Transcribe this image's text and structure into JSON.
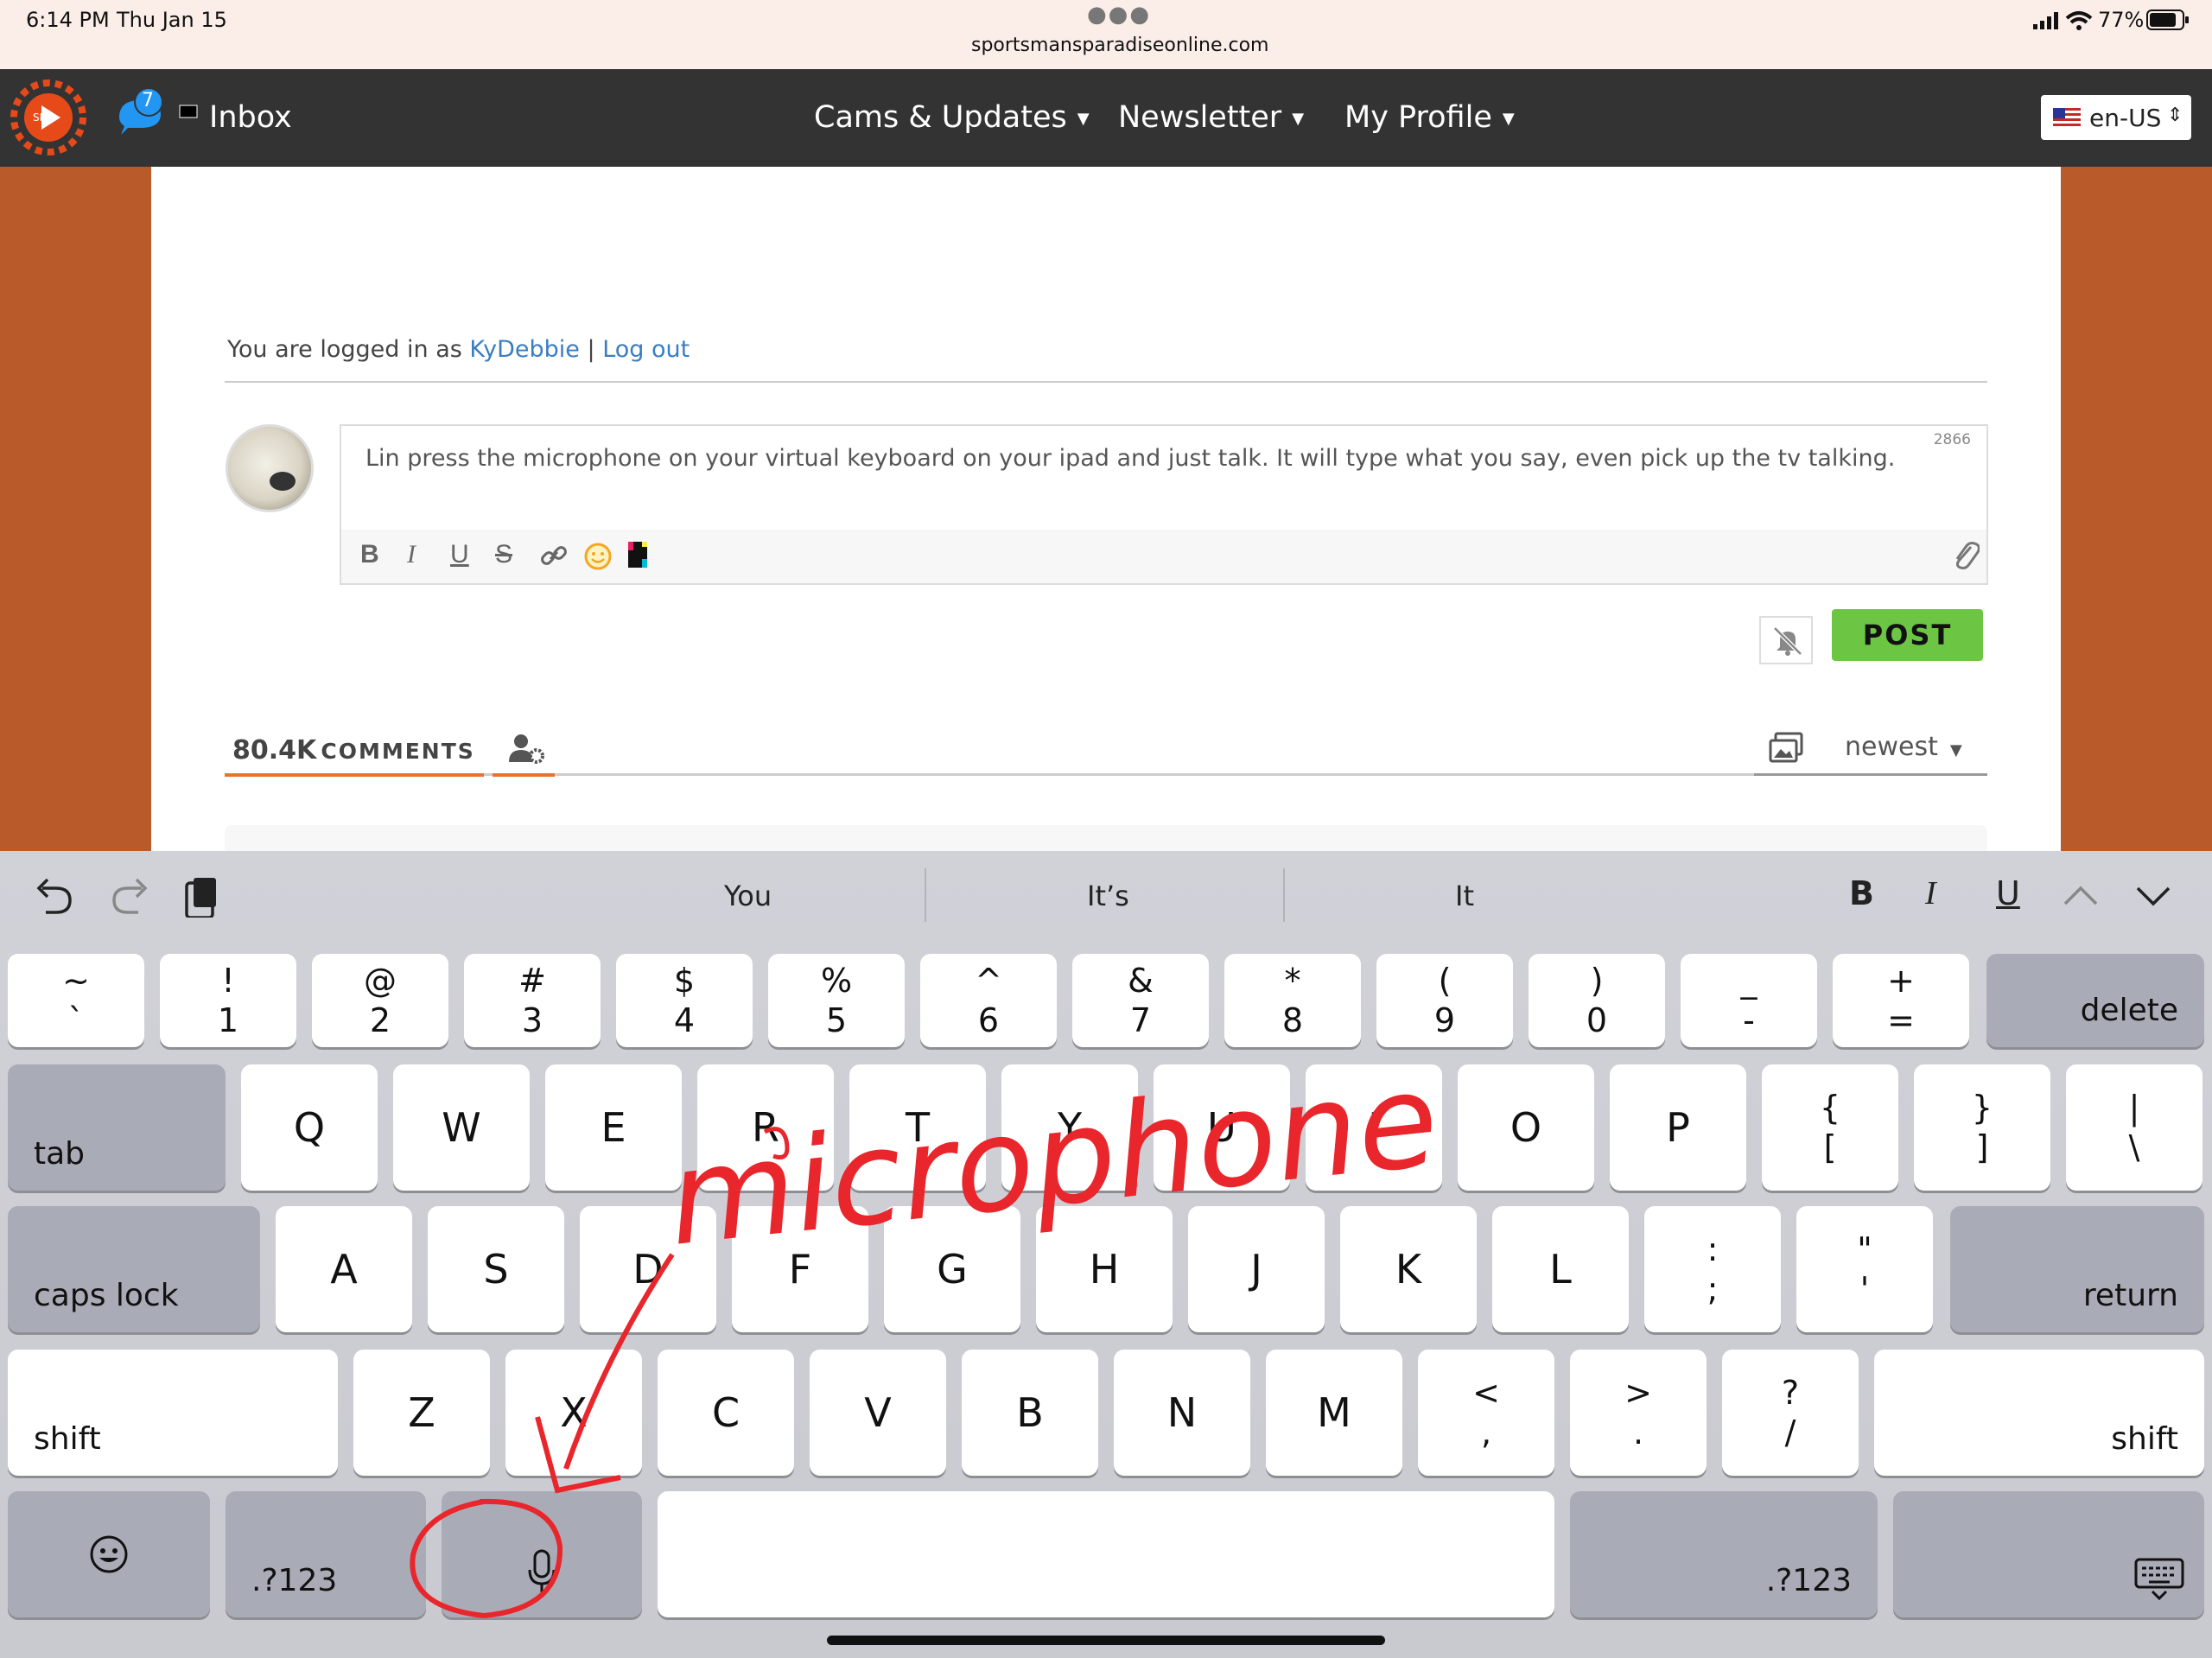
{
  "status": {
    "time": "6:14 PM",
    "date": "Thu Jan 15",
    "url": "sportsmansparadiseonline.com",
    "battery": "77%"
  },
  "nav": {
    "notif_count": "7",
    "inbox": "Inbox",
    "menu": [
      "Cams & Updates",
      "Newsletter",
      "My Profile"
    ],
    "locale": "en-US"
  },
  "comments": {
    "logged_prefix": "You are logged in as",
    "username": "KyDebbie",
    "separator": "|",
    "logout": "Log out",
    "char_count": "2866",
    "draft": "Lin press the microphone on your virtual keyboard on your ipad and just talk. It will type what you say, even pick up the tv talking.",
    "post": "POST",
    "count": "80.4K",
    "count_label": "COMMENTS",
    "sort": "newest"
  },
  "keyboard": {
    "suggestions": [
      "You",
      "It’s",
      "It"
    ],
    "format": [
      "B",
      "I",
      "U"
    ],
    "row1": [
      [
        "~",
        "`"
      ],
      [
        "!",
        "1"
      ],
      [
        "@",
        "2"
      ],
      [
        "#",
        "3"
      ],
      [
        "$",
        "4"
      ],
      [
        "%",
        "5"
      ],
      [
        "^",
        "6"
      ],
      [
        "&",
        "7"
      ],
      [
        "*",
        "8"
      ],
      [
        "(",
        "9"
      ],
      [
        ")",
        "0"
      ],
      [
        "_",
        "-"
      ],
      [
        "+",
        "="
      ]
    ],
    "delete": "delete",
    "tab": "tab",
    "row2": [
      "Q",
      "W",
      "E",
      "R",
      "T",
      "Y",
      "U",
      "I",
      "O",
      "P"
    ],
    "row2sym": [
      [
        "{",
        "["
      ],
      [
        "}",
        "]"
      ],
      [
        "|",
        "\\"
      ]
    ],
    "caps": "caps lock",
    "row3": [
      "A",
      "S",
      "D",
      "F",
      "G",
      "H",
      "J",
      "K",
      "L"
    ],
    "row3sym": [
      [
        ":",
        ";"
      ],
      [
        "\"",
        "'"
      ]
    ],
    "return": "return",
    "shift": "shift",
    "row4": [
      "Z",
      "X",
      "C",
      "V",
      "B",
      "N",
      "M"
    ],
    "row4sym": [
      [
        "<",
        ","
      ],
      [
        ">",
        "."
      ],
      [
        "?",
        "/"
      ]
    ],
    "num": ".?123"
  },
  "annotation": "microphone",
  "colors": {
    "site_bg": "#b95a2a",
    "nav_bg": "#333333",
    "post_green": "#6cc644",
    "accent_orange": "#e8722e",
    "annotation_red": "#e8262b"
  }
}
